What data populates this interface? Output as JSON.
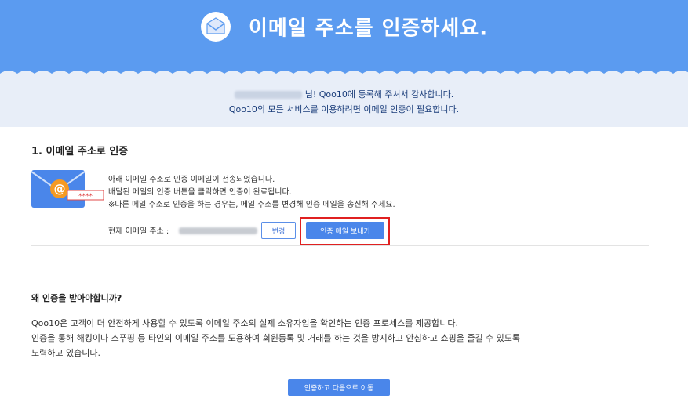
{
  "header": {
    "title": "이메일 주소를 인증하세요.",
    "icon": "envelope-icon",
    "bg_color": "#5b9bf0"
  },
  "greeting": {
    "line1": "님! Qoo10에 등록해 주셔서 감사합니다.",
    "line2": "Qoo10의 모든 서비스를 이용하려면 이메일 인증이 필요합니다."
  },
  "section1": {
    "title": "1. 이메일 주소로 인증",
    "illustration": "email-at-icon",
    "illustration_mask": "****",
    "desc": [
      "아래 이메일 주소로 인증 이메일이 전송되었습니다.",
      "배달된 메일의 인증 버튼을 클릭하면 인증이 완료됩니다.",
      "※다른 메일 주소로 인증을 하는 경우는, 메일 주소를 변경해 인증 메일을 송신해 주세요."
    ],
    "current_email_label": "현재 이메일 주소 :",
    "change_button": "변경",
    "send_button": "인증 메일 보내기",
    "highlight_color": "#e02020"
  },
  "why": {
    "title": "왜 인증을 받아야합니까?",
    "body": [
      "Qoo10은 고객이 더 안전하게 사용할 수 있도록 이메일 주소의 실제 소유자임을 확인하는 인증 프로세스를 제공합니다.",
      "인증을 통해 해킹이나 스푸핑 등 타인의 이메일 주소를 도용하여 회원등록 및 거래를 하는 것을 방지하고 안심하고 쇼핑을 즐길 수 있도록",
      "노력하고 있습니다."
    ]
  },
  "footer": {
    "next_button": "인증하고 다음으로 이동",
    "accent_color": "#4a86ea"
  }
}
